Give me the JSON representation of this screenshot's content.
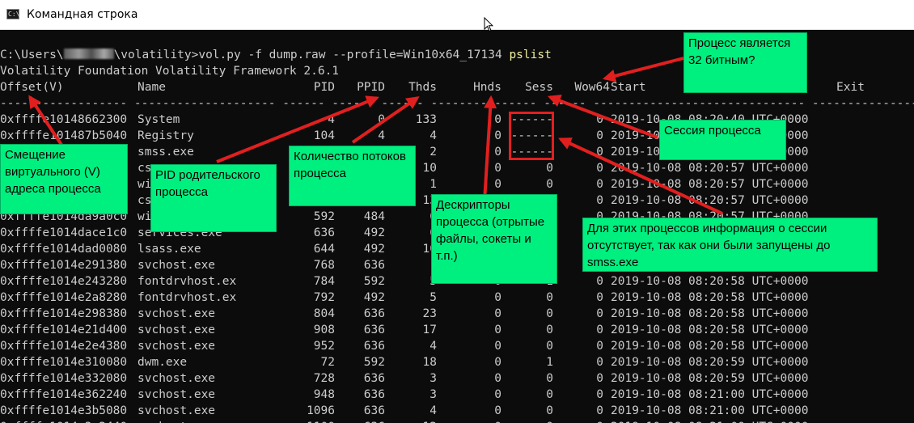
{
  "window": {
    "title": "Командная строка",
    "icon": "cmd-icon"
  },
  "prompt": {
    "path_start": "C:\\Users\\",
    "path_end": "\\volatility>",
    "command": "vol.py -f dump.raw --profile=Win10x64_17134 ",
    "plugin": "pslist"
  },
  "banner": "Volatility Foundation Volatility Framework 2.6.1",
  "table": {
    "headers": [
      "Offset(V)",
      "Name",
      "PID",
      "PPID",
      "Thds",
      "Hnds",
      "Sess",
      "Wow64",
      "Start",
      "Exit"
    ],
    "separator": "------------------ -------------------- ------ ------ ------ -------- ------ ------ ------------------------------ ------------------------------",
    "rows": [
      [
        "0xffffe10148662300",
        "System",
        "4",
        "0",
        "133",
        "0",
        "------",
        "0",
        "2019-10-08 08:20:40 UTC+0000"
      ],
      [
        "0xffffe101487b5040",
        "Registry",
        "104",
        "4",
        "4",
        "0",
        "------",
        "0",
        "2019-10-08 08:20:57 UTC+0000"
      ],
      [
        "0xffffe1014924e040",
        "smss.exe",
        "",
        "",
        "2",
        "0",
        "------",
        "0",
        "2019-10-08 08:20:57 UTC+0000"
      ],
      [
        "0xffffe1014c83f080",
        "csrss.exe",
        "",
        "",
        "10",
        "0",
        "0",
        "0",
        "2019-10-08 08:20:57 UTC+0000"
      ],
      [
        "0xffffe1014d4f3080",
        "wininit.exe",
        "",
        "",
        "1",
        "0",
        "0",
        "0",
        "2019-10-08 08:20:57 UTC+0000"
      ],
      [
        "0xffffe1014d8a2080",
        "csrss.exe",
        "",
        "",
        "13",
        "0",
        "1",
        "0",
        "2019-10-08 08:20:57 UTC+0000"
      ],
      [
        "0xffffe1014da9a0c0",
        "winlogon.exe",
        "592",
        "484",
        "6",
        "0",
        "1",
        "0",
        "2019-10-08 08:20:57 UTC+0000"
      ],
      [
        "0xffffe1014dace1c0",
        "services.exe",
        "636",
        "492",
        "6",
        "0",
        "0",
        "0",
        "2019-10-08 08:20:57 UTC+0000"
      ],
      [
        "0xffffe1014dad0080",
        "lsass.exe",
        "644",
        "492",
        "10",
        "0",
        "0",
        "0",
        "2019-10-08 08:20:57 UTC+0000"
      ],
      [
        "0xffffe1014e291380",
        "svchost.exe",
        "768",
        "636",
        "1",
        "0",
        "0",
        "0",
        "2019-10-08 08:20:58 UTC+0000"
      ],
      [
        "0xffffe1014e243280",
        "fontdrvhost.ex",
        "784",
        "592",
        "5",
        "0",
        "1",
        "0",
        "2019-10-08 08:20:58 UTC+0000"
      ],
      [
        "0xffffe1014e2a8280",
        "fontdrvhost.ex",
        "792",
        "492",
        "5",
        "0",
        "0",
        "0",
        "2019-10-08 08:20:58 UTC+0000"
      ],
      [
        "0xffffe1014e298380",
        "svchost.exe",
        "804",
        "636",
        "23",
        "0",
        "0",
        "0",
        "2019-10-08 08:20:58 UTC+0000"
      ],
      [
        "0xffffe1014e21d400",
        "svchost.exe",
        "908",
        "636",
        "17",
        "0",
        "0",
        "0",
        "2019-10-08 08:20:58 UTC+0000"
      ],
      [
        "0xffffe1014e2e4380",
        "svchost.exe",
        "952",
        "636",
        "4",
        "0",
        "0",
        "0",
        "2019-10-08 08:20:58 UTC+0000"
      ],
      [
        "0xffffe1014e310080",
        "dwm.exe",
        "72",
        "592",
        "18",
        "0",
        "1",
        "0",
        "2019-10-08 08:20:59 UTC+0000"
      ],
      [
        "0xffffe1014e332080",
        "svchost.exe",
        "728",
        "636",
        "3",
        "0",
        "0",
        "0",
        "2019-10-08 08:20:59 UTC+0000"
      ],
      [
        "0xffffe1014e362240",
        "svchost.exe",
        "948",
        "636",
        "3",
        "0",
        "0",
        "0",
        "2019-10-08 08:21:00 UTC+0000"
      ],
      [
        "0xffffe1014e3b5080",
        "svchost.exe",
        "1096",
        "636",
        "4",
        "0",
        "0",
        "0",
        "2019-10-08 08:21:00 UTC+0000"
      ],
      [
        "0xffffe1014e3c2440",
        "svchost.exe",
        "1100",
        "636",
        "12",
        "0",
        "0",
        "0",
        "2019-10-08 08:21:00 UTC+0000"
      ]
    ]
  },
  "annotations": {
    "offset": "Смещение виртуального (V) адреса процесса",
    "ppid": "PID родительского процесса",
    "threads": "Количество потоков процесса",
    "handles": "Дескрипторы процесса (отрытые файлы, сокеты и т.п.)",
    "session": "Сессия процесса",
    "wow64": "Процесс является 32 битным?",
    "no_session": "Для этих процессов информация о сессии отсутствует, так как они были запущены до smss.exe"
  },
  "colors": {
    "background": "#0c0c0c",
    "text": "#cccccc",
    "note_bg": "#00f080",
    "arrow": "#e21f1f",
    "plugin_text": "#f1f1a0"
  }
}
